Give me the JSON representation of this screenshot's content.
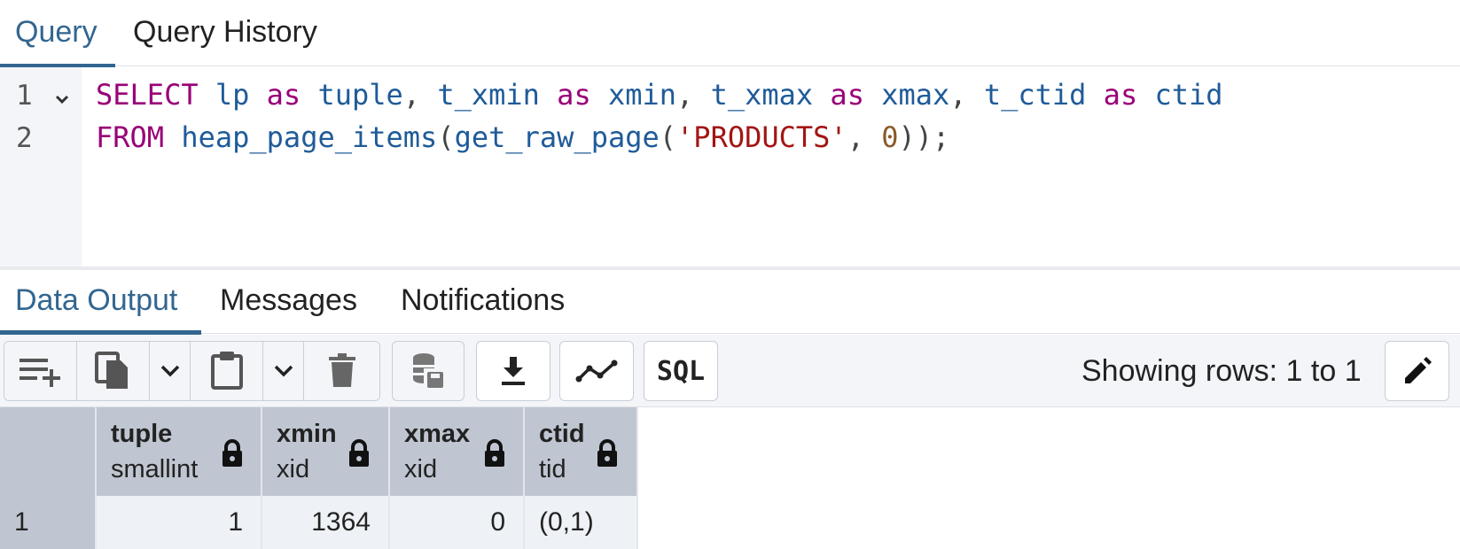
{
  "tabs": {
    "query": "Query",
    "history": "Query History"
  },
  "editor": {
    "line_numbers": [
      "1",
      "2"
    ],
    "line1": {
      "t1": "SELECT",
      "t2": " ",
      "t3": "lp",
      "t4": " ",
      "t5": "as",
      "t6": " ",
      "t7": "tuple",
      "t8": ", ",
      "t9": "t_xmin",
      "t10": " ",
      "t11": "as",
      "t12": " ",
      "t13": "xmin",
      "t14": ", ",
      "t15": "t_xmax",
      "t16": " ",
      "t17": "as",
      "t18": " ",
      "t19": "xmax",
      "t20": ", ",
      "t21": "t_ctid",
      "t22": " ",
      "t23": "as",
      "t24": " ",
      "t25": "ctid"
    },
    "line2": {
      "t1": "FROM",
      "t2": " ",
      "t3": "heap_page_items",
      "t4": "(",
      "t5": "get_raw_page",
      "t6": "(",
      "t7": "'PRODUCTS'",
      "t8": ", ",
      "t9": "0",
      "t10": "));"
    }
  },
  "result_tabs": {
    "data_output": "Data Output",
    "messages": "Messages",
    "notifications": "Notifications"
  },
  "toolbar": {
    "sql_label": "SQL",
    "rows_label": "Showing rows: 1 to 1"
  },
  "grid": {
    "columns": [
      {
        "name": "tuple",
        "type": "smallint"
      },
      {
        "name": "xmin",
        "type": "xid"
      },
      {
        "name": "xmax",
        "type": "xid"
      },
      {
        "name": "ctid",
        "type": "tid"
      }
    ],
    "rows": [
      {
        "rownum": "1",
        "cells": [
          "1",
          "1364",
          "0",
          "(0,1)"
        ]
      }
    ]
  },
  "colors": {
    "accent": "#326690",
    "keyword": "#990077",
    "identifier": "#1f5b99",
    "string": "#a31515",
    "number": "#8a5a2b",
    "header_bg": "#bfc6d1"
  }
}
